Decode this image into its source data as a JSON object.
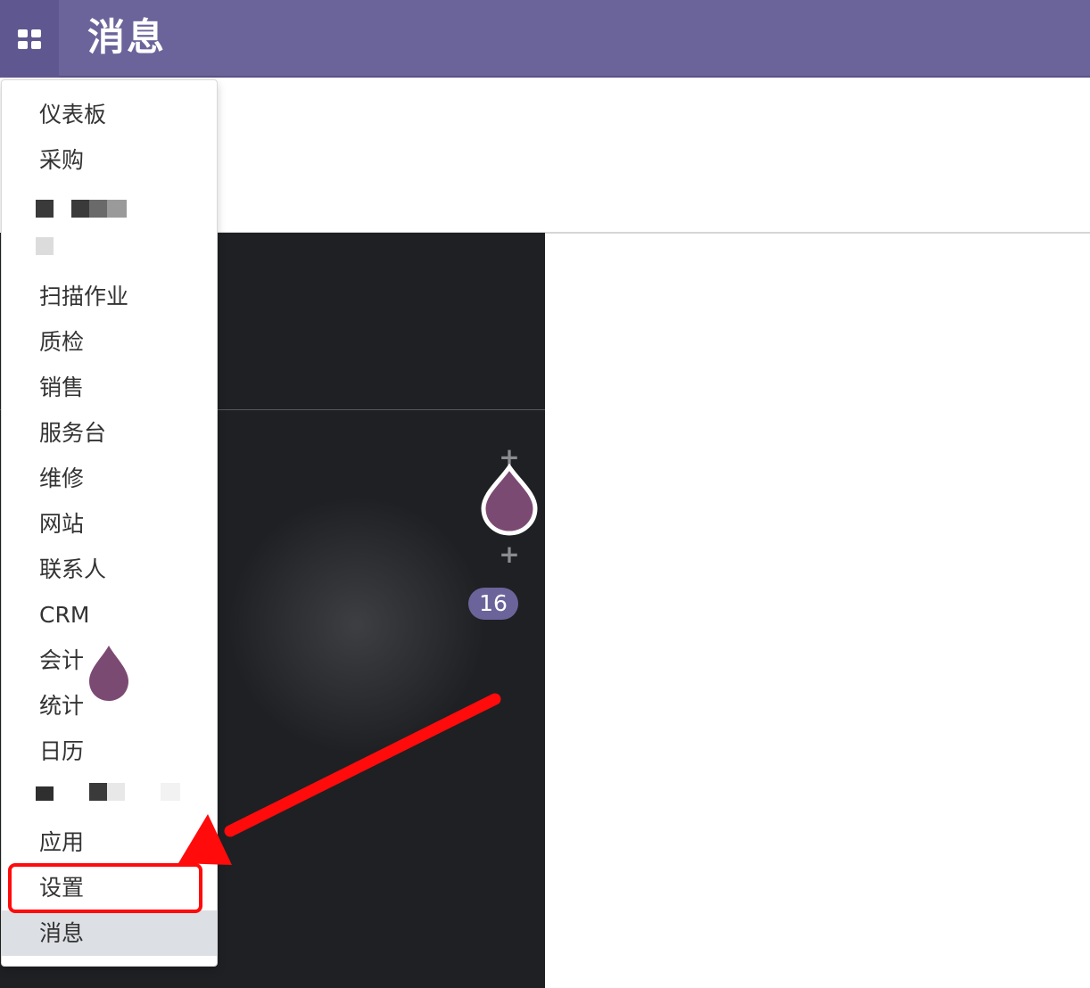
{
  "navbar": {
    "title": "消息",
    "apps_icon": "grid-icon",
    "color": "#6b649b"
  },
  "menu": {
    "items": [
      {
        "label": "仪表板"
      },
      {
        "label": "采购"
      },
      {
        "label": "扫描作业"
      },
      {
        "label": "质检"
      },
      {
        "label": "销售"
      },
      {
        "label": "服务台"
      },
      {
        "label": "维修"
      },
      {
        "label": "网站"
      },
      {
        "label": "联系人"
      },
      {
        "label": "CRM"
      },
      {
        "label": "会计"
      },
      {
        "label": "统计"
      },
      {
        "label": "日历"
      },
      {
        "label": "应用"
      },
      {
        "label": "设置"
      },
      {
        "label": "消息"
      }
    ],
    "active_item": "消息",
    "highlighted_item": "设置"
  },
  "background": {
    "counter": "16",
    "drop_icon": "droplet-icon",
    "plus_icon": "plus-icon"
  },
  "annotation": {
    "color": "#ff0b0b"
  }
}
